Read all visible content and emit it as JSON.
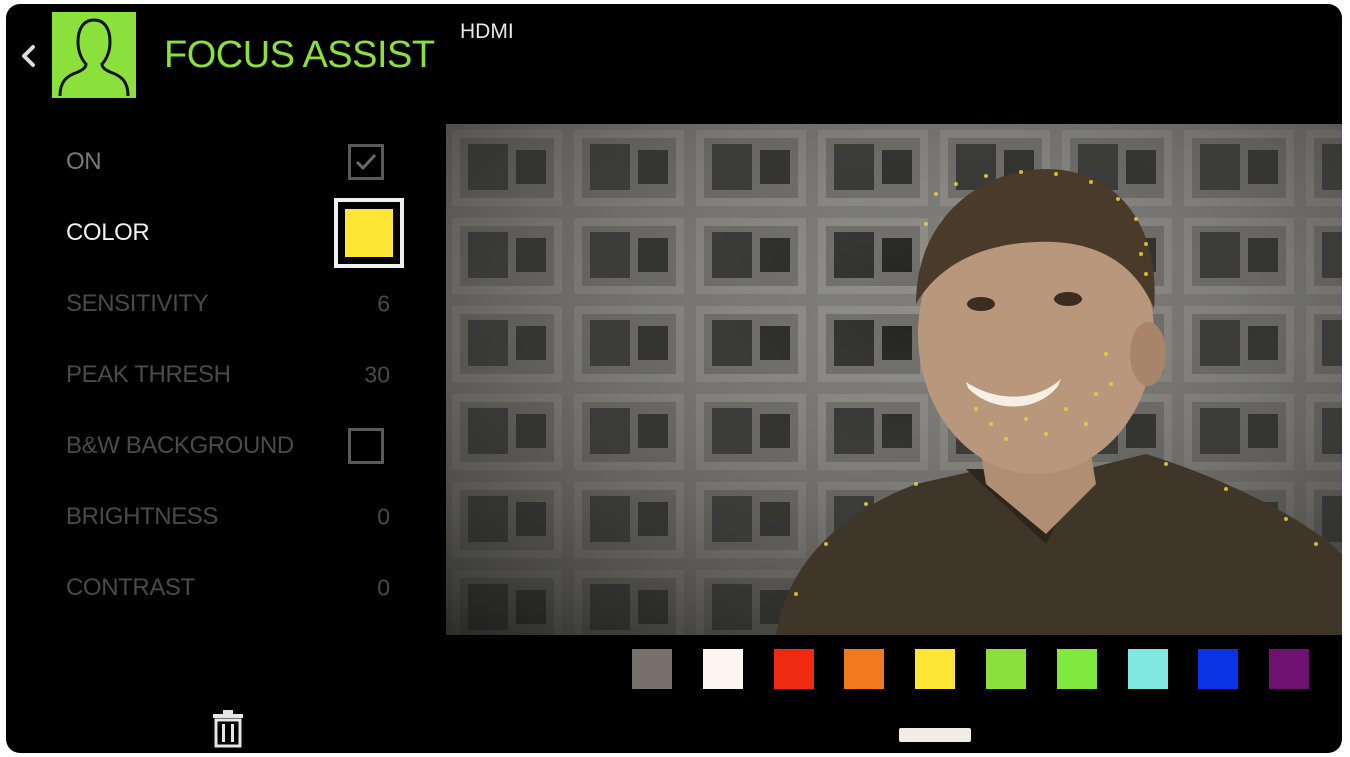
{
  "header": {
    "title": "FOCUS ASSIST",
    "source": "HDMI",
    "accent_color": "#8be03c",
    "back_icon": "chevron-left-icon",
    "title_icon": "person-silhouette-icon"
  },
  "menu": {
    "on": {
      "label": "ON",
      "checked": true
    },
    "color": {
      "label": "COLOR",
      "value_color": "#ffe536"
    },
    "sensitivity": {
      "label": "SENSITIVITY",
      "value": "6"
    },
    "peak_thresh": {
      "label": "PEAK THRESH",
      "value": "30"
    },
    "bw_background": {
      "label": "B&W BACKGROUND",
      "checked": false
    },
    "brightness": {
      "label": "BRIGHTNESS",
      "value": "0"
    },
    "contrast": {
      "label": "CONTRAST",
      "value": "0"
    }
  },
  "footer": {
    "delete_icon": "trash-icon"
  },
  "preview": {
    "description_icon": "video-preview"
  },
  "palette": {
    "selected_color": "#ffe536",
    "colors": [
      "#77716c",
      "#fff5f0",
      "#ee2a10",
      "#f27a1e",
      "#ffe536",
      "#8be03c",
      "#7ee83c",
      "#7fe6e0",
      "#0a33e6",
      "#6e1170"
    ]
  }
}
